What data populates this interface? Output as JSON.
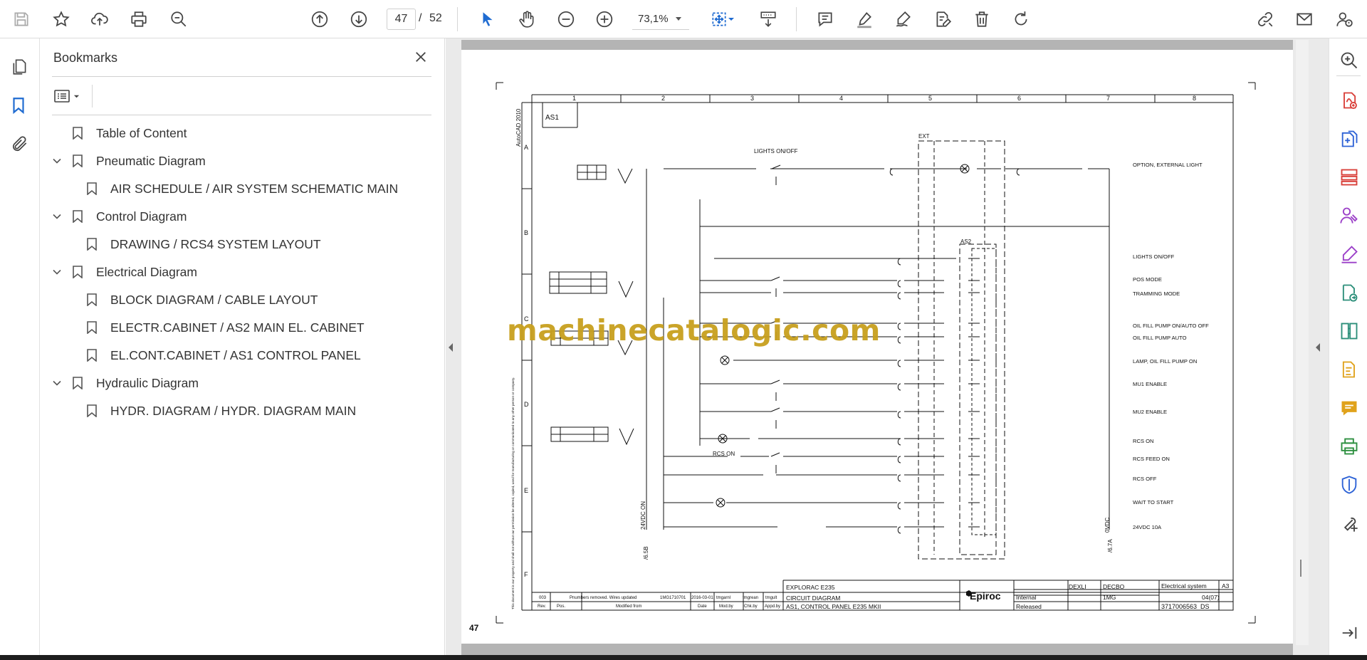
{
  "toolbar": {
    "current_page": "47",
    "page_separator": "/",
    "total_pages": "52",
    "zoom": "73,1%"
  },
  "bookmarks": {
    "title": "Bookmarks",
    "items": [
      {
        "label": "Table of Content",
        "level": 0,
        "expandable": false
      },
      {
        "label": "Pneumatic Diagram",
        "level": 0,
        "expandable": true
      },
      {
        "label": "AIR SCHEDULE / AIR SYSTEM SCHEMATIC MAIN",
        "level": 1,
        "expandable": false
      },
      {
        "label": "Control Diagram",
        "level": 0,
        "expandable": true
      },
      {
        "label": "DRAWING / RCS4 SYSTEM LAYOUT",
        "level": 1,
        "expandable": false
      },
      {
        "label": "Electrical Diagram",
        "level": 0,
        "expandable": true
      },
      {
        "label": "BLOCK DIAGRAM / CABLE LAYOUT",
        "level": 1,
        "expandable": false
      },
      {
        "label": "ELECTR.CABINET / AS2 MAIN EL. CABINET",
        "level": 1,
        "expandable": false
      },
      {
        "label": "EL.CONT.CABINET / AS1 CONTROL PANEL",
        "level": 1,
        "expandable": false
      },
      {
        "label": "Hydraulic Diagram",
        "level": 0,
        "expandable": true
      },
      {
        "label": "HYDR. DIAGRAM / HYDR. DIAGRAM MAIN",
        "level": 1,
        "expandable": false
      }
    ]
  },
  "document": {
    "watermark": "machinecatalogic.com",
    "page_number": "47",
    "diagram": {
      "side_note": "AutoCAD 2010",
      "panel_label": "AS1",
      "columns": [
        "1",
        "2",
        "3",
        "4",
        "5",
        "6",
        "7",
        "8"
      ],
      "rows": [
        "A",
        "B",
        "C",
        "D",
        "E",
        "F"
      ],
      "ext_label": "EXT",
      "as2_label": "AS2",
      "lights_switch": "LIGHTS ON/OFF",
      "right_labels": [
        "OPTION, EXTERNAL LIGHT",
        "LIGHTS ON/OFF",
        "POS MODE",
        "TRAMMING MODE",
        "OIL FILL PUMP ON/AUTO OFF",
        "OIL FILL PUMP AUTO",
        "LAMP, OIL FILL PUMP ON",
        "MU1 ENABLE",
        "MU2 ENABLE",
        "RCS ON",
        "RCS FEED ON",
        "RCS OFF",
        "WAIT TO START",
        "24VDC 10A"
      ],
      "left_vertical": "24VDC ON",
      "left_ref": "/6.5B",
      "right_vertical": "0VDC",
      "right_ref": "/6.7A",
      "rcs_on": "RCS ON",
      "left_disclaimer": "This document is our property and shall not without our permission be altered, copied, used for manufacturing or communicated to any other person or company.",
      "titleblock": {
        "name": "EXPLORAC E235",
        "type": "CIRCUIT DIAGRAM",
        "desc": "AS1, CONTROL PANEL E235 MKII",
        "brand": "Epiroc",
        "rev": "003",
        "rev_text": "Pnumbers removed. Wires updated",
        "rev_no": "1MG1710701",
        "rev_date": "2016-03-01",
        "created": "DEXLI",
        "approved": "DECBO",
        "conf": "Internal",
        "status": "Released",
        "group": "1MG",
        "sheet": "04(07)",
        "size": "A3",
        "doc_no": "3717006563_DS",
        "sys": "Electrical system",
        "hdr_rev": "Rev.",
        "hdr_pos": "Pos.",
        "hdr_mod": "Modified from",
        "hdr_date": "Date",
        "hdr_modby": "Mod.by",
        "hdr_chk": "Chk.by",
        "hdr_appd": "Appd.by",
        "p1": "tmgarnl",
        "p2": "tmgrean",
        "p3": "tmgult"
      }
    }
  }
}
